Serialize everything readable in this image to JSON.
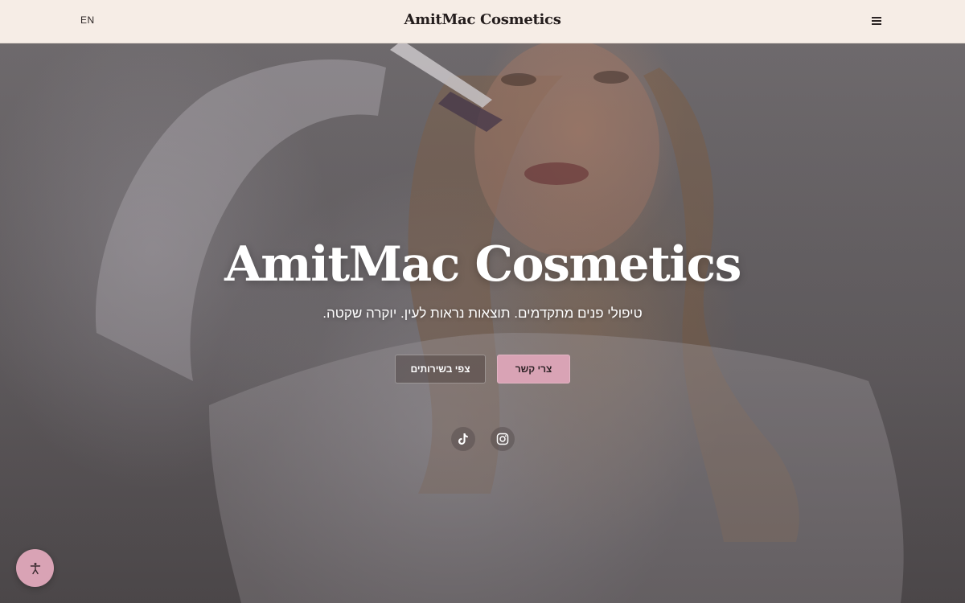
{
  "header": {
    "lang_label": "EN",
    "brand": "AmitMac Cosmetics",
    "menu_icon": "hamburger-menu-icon"
  },
  "hero": {
    "title": "AmitMac Cosmetics",
    "subtitle": "טיפולי פנים מתקדמים. תוצאות נראות לעין. יוקרה שקטה.",
    "buttons": {
      "services_label": "צפי בשירותים",
      "contact_label": "צרי קשר"
    },
    "social": [
      {
        "name": "tiktok-icon"
      },
      {
        "name": "instagram-icon"
      }
    ]
  },
  "accessibility": {
    "icon": "accessibility-icon"
  },
  "colors": {
    "header_bg": "#f6ede6",
    "accent_pink": "#d9a3b5",
    "text_dark": "#241d1d"
  }
}
